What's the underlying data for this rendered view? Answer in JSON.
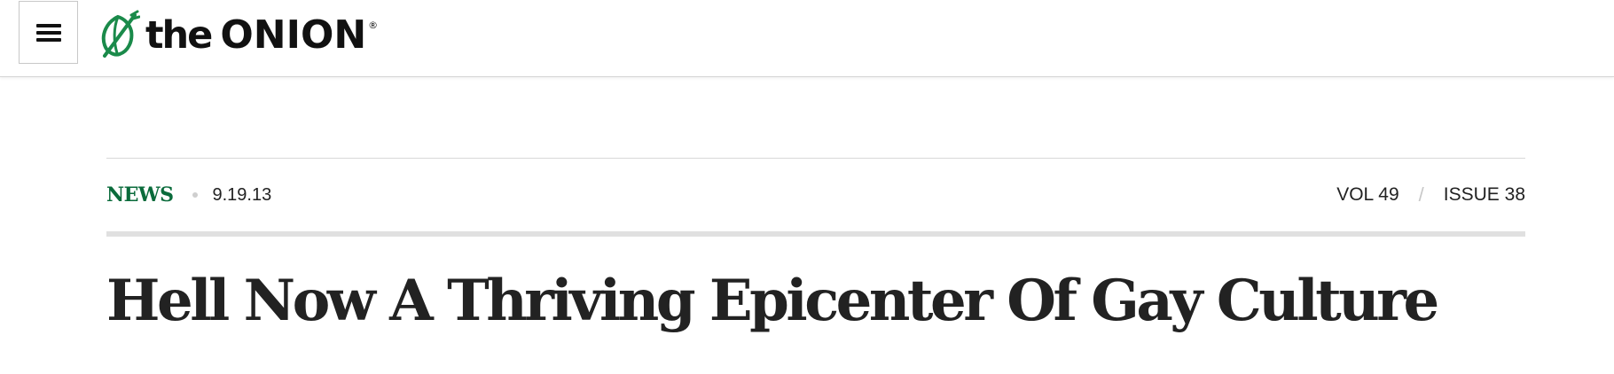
{
  "header": {
    "menu_icon": "hamburger-menu-icon",
    "logo": {
      "icon": "onion-logo-icon",
      "word_the": "the",
      "word_onion": "ONION",
      "registered": "®",
      "brand_color": "#1a8a4a"
    }
  },
  "article": {
    "category": "NEWS",
    "category_color": "#0a6b3b",
    "date": "9.19.13",
    "volume": "VOL 49",
    "separator": "/",
    "issue": "ISSUE 38",
    "headline": "Hell Now A Thriving Epicenter Of Gay Culture"
  }
}
